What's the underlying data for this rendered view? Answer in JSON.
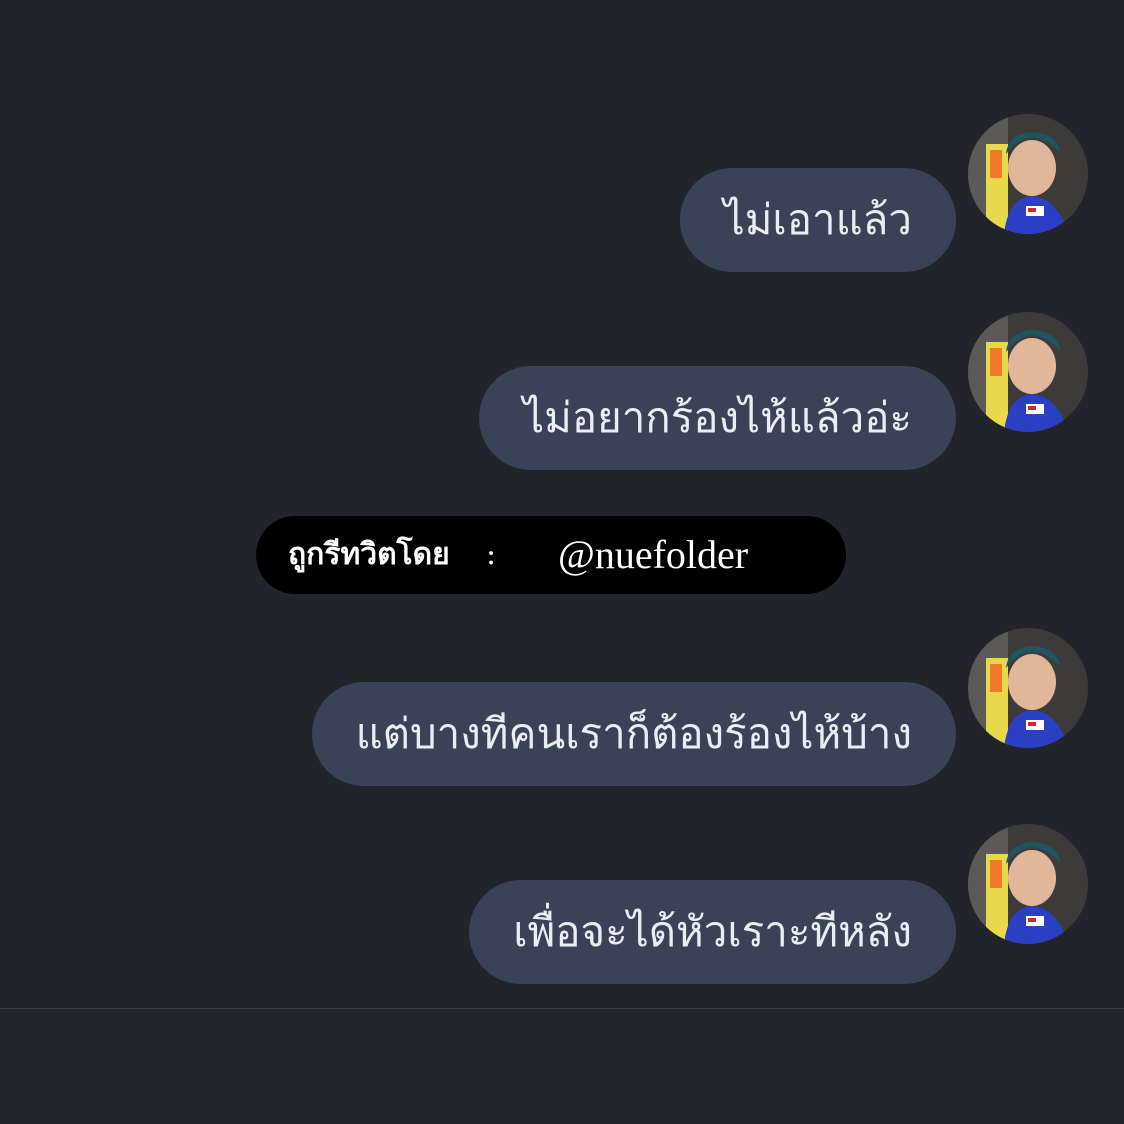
{
  "messages": [
    {
      "text": "ไม่เอาแล้ว",
      "avatar": "profile-avatar"
    },
    {
      "text": "ไม่อยากร้องไห้แล้วอ่ะ",
      "avatar": "profile-avatar"
    },
    {
      "text": "แต่บางทีคนเราก็ต้องร้องไห้บ้าง",
      "avatar": "profile-avatar"
    },
    {
      "text": "เพื่อจะได้หัวเราะทีหลัง",
      "avatar": "profile-avatar"
    }
  ],
  "retweet_banner": {
    "label": "ถูกรีทวิตโดย",
    "separator": ":",
    "handle": "@nuefolder"
  },
  "colors": {
    "background": "#23242b",
    "bubble": "#3a4257",
    "bubble_text": "#e9edf4",
    "banner": "#000000"
  }
}
